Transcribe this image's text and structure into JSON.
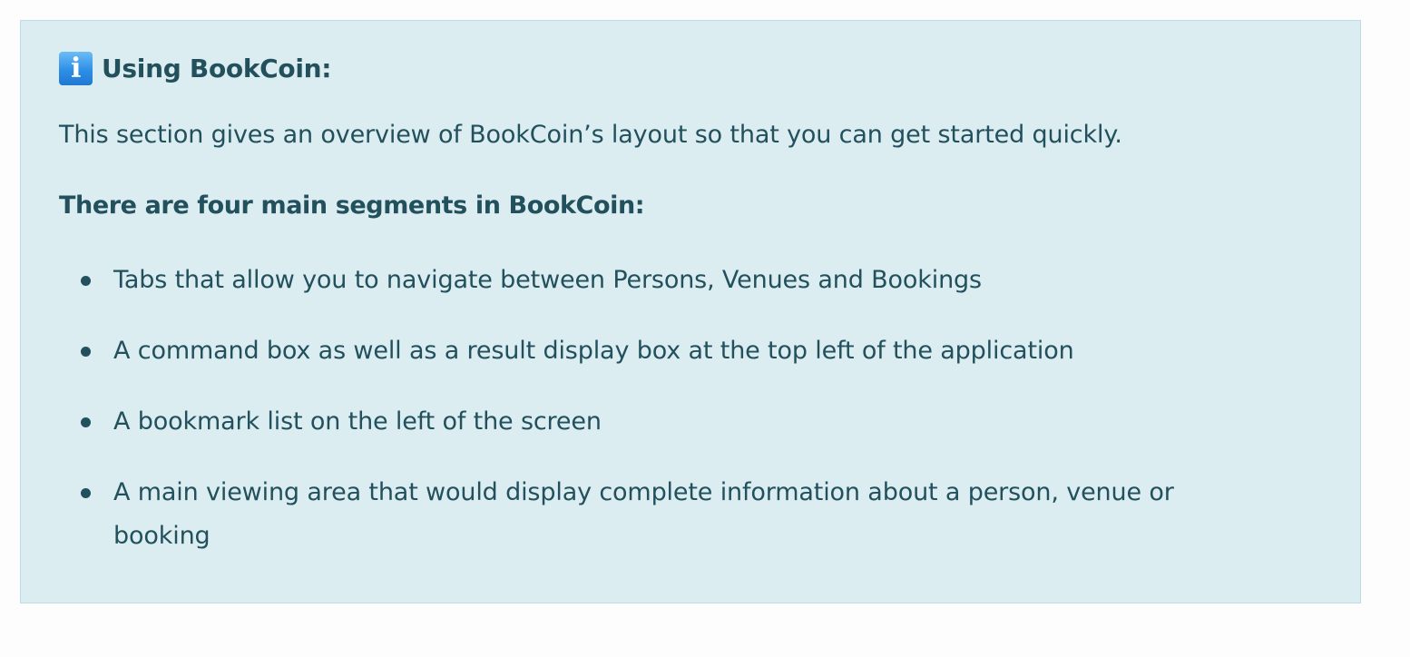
{
  "note": {
    "icon": "info-icon",
    "icon_glyph": "i",
    "title": "Using BookCoin:",
    "intro": "This section gives an overview of BookCoin’s layout so that you can get started quickly.",
    "subheading": "There are four main segments in BookCoin:",
    "items": [
      "Tabs that allow you to navigate between Persons, Venues and Bookings",
      "A command box as well as a result display box at the top left of the application",
      "A bookmark list on the left of the screen",
      "A main viewing area that would display complete information about a person, venue or booking"
    ]
  },
  "colors": {
    "box_background": "#dbedf1",
    "box_border": "#bcdde6",
    "text": "#22505d",
    "icon_blue": "#2e8fe6"
  }
}
